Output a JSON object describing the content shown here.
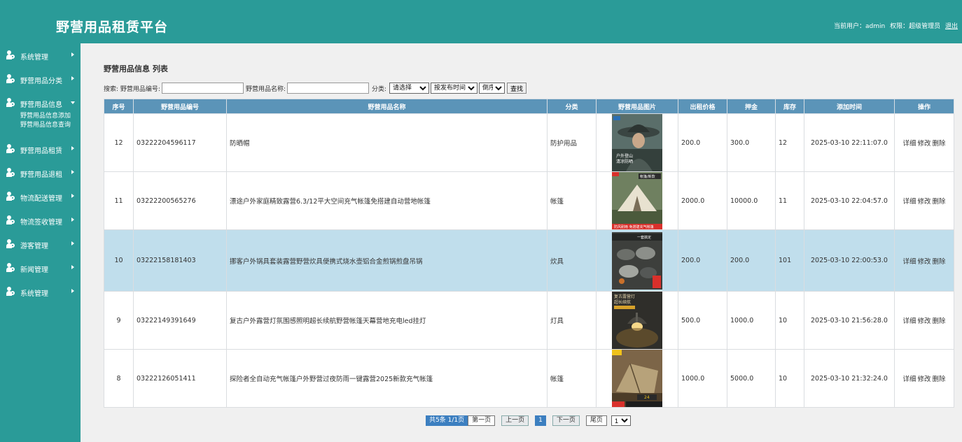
{
  "header": {
    "title": "野营用品租赁平台",
    "current_user_label": "当前用户：admin",
    "role_label": "权限：超级管理员",
    "logout": "退出"
  },
  "sidebar": {
    "items": [
      {
        "label": "系统管理",
        "expanded": false
      },
      {
        "label": "野营用品分类",
        "expanded": false
      },
      {
        "label": "野营用品信息",
        "expanded": true,
        "children": [
          "野营用品信息添加",
          "野营用品信息查询"
        ]
      },
      {
        "label": "野营用品租赁",
        "expanded": false
      },
      {
        "label": "野营用品退租",
        "expanded": false
      },
      {
        "label": "物流配送管理",
        "expanded": false
      },
      {
        "label": "物流签收管理",
        "expanded": false
      },
      {
        "label": "游客管理",
        "expanded": false
      },
      {
        "label": "新闻管理",
        "expanded": false
      },
      {
        "label": "系统管理",
        "expanded": false
      }
    ]
  },
  "main": {
    "page_title": "野营用品信息 列表",
    "search": {
      "code_label": "搜索: 野营用品编号:",
      "code_value": "",
      "name_label": "野营用品名称:",
      "name_value": "",
      "category_label": "分类:",
      "category_selected": "请选择",
      "sort_field_selected": "按发布时间",
      "sort_order_selected": "倒序",
      "search_button": "查找"
    },
    "table": {
      "columns": [
        "序号",
        "野营用品编号",
        "野营用品名称",
        "分类",
        "野营用品图片",
        "出租价格",
        "押金",
        "库存",
        "添加时间",
        "操作"
      ],
      "rows": [
        {
          "id": "12",
          "code": "03222204596117",
          "name": "防晒帽",
          "category": "防护用品",
          "price": "200.0",
          "deposit": "300.0",
          "stock": "12",
          "added": "2025-03-10 22:11:07.0",
          "image": "sun-hat-photo"
        },
        {
          "id": "11",
          "code": "03222200565276",
          "name": "漂途户外家庭精致露营6.3/12平大空间充气帐篷免搭建自动营地帐篷",
          "category": "帐篷",
          "price": "2000.0",
          "deposit": "10000.0",
          "stock": "11",
          "added": "2025-03-10 22:04:57.0",
          "image": "inflatable-tent-photo"
        },
        {
          "id": "10",
          "code": "03222158181403",
          "name": "挪客户外锅具套装露营野营炊具便携式烧水壶铝合金煎锅煎盘吊锅",
          "category": "炊具",
          "price": "200.0",
          "deposit": "200.0",
          "stock": "101",
          "added": "2025-03-10 22:00:53.0",
          "image": "cookware-set-photo"
        },
        {
          "id": "9",
          "code": "03222149391649",
          "name": "复古户外露营灯氛围感照明超长续航野营帐篷天幕营地充电led挂灯",
          "category": "灯具",
          "price": "500.0",
          "deposit": "1000.0",
          "stock": "10",
          "added": "2025-03-10 21:56:28.0",
          "image": "camping-lamp-photo"
        },
        {
          "id": "8",
          "code": "03222126051411",
          "name": "探险者全自动充气帐篷户外野营过夜防雨一键露营2025新款充气帐篷",
          "category": "帐篷",
          "price": "1000.0",
          "deposit": "5000.0",
          "stock": "10",
          "added": "2025-03-10 21:32:24.0",
          "image": "auto-tent-photo"
        }
      ],
      "ops": {
        "detail": "详细",
        "edit": "修改",
        "delete": "删除"
      },
      "highlighted_row_id": "10"
    },
    "images": {
      "sun_hat_text": "户外登山\n清凉防晒",
      "tent_banner": "防风耐雨 免搭建充气帐篷",
      "tent_top_text": "帐篷/新款",
      "cookware_top_text": "一套搞定",
      "lamp_text": "复古露营灯\n超长续航",
      "auto_tent_bottom": "24"
    },
    "pager": {
      "info": "共5条  1/1页",
      "first": "第一页",
      "prev": "上一页",
      "current": "1",
      "next": "下一页",
      "last": "尾页",
      "page_select": "1"
    }
  },
  "colors": {
    "header_bg": "#2a9b98",
    "table_header_bg": "#5b94b8",
    "highlight_row": "#c0deec",
    "pager_blue": "#3c7fc0"
  }
}
